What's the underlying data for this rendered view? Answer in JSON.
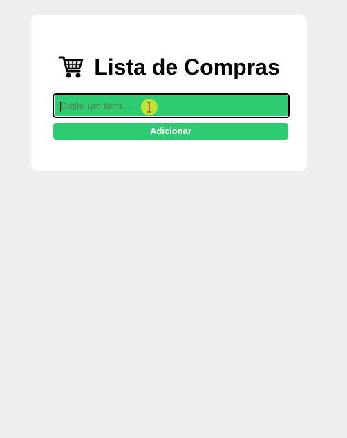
{
  "app": {
    "title": "Lista de Compras",
    "title_icon": "shopping-cart-icon",
    "add_item_input": {
      "value": "",
      "placeholder": "Digite um item..."
    },
    "add_button_label": "Adicionar"
  },
  "colors": {
    "page_background": "#efeeec",
    "card_background": "#ffffff",
    "accent_green": "#2ecc71",
    "title_text": "#000000",
    "button_text": "#ffffff"
  },
  "pointer": {
    "icon": "text-cursor-icon",
    "highlight": "yellow-green-halo"
  }
}
